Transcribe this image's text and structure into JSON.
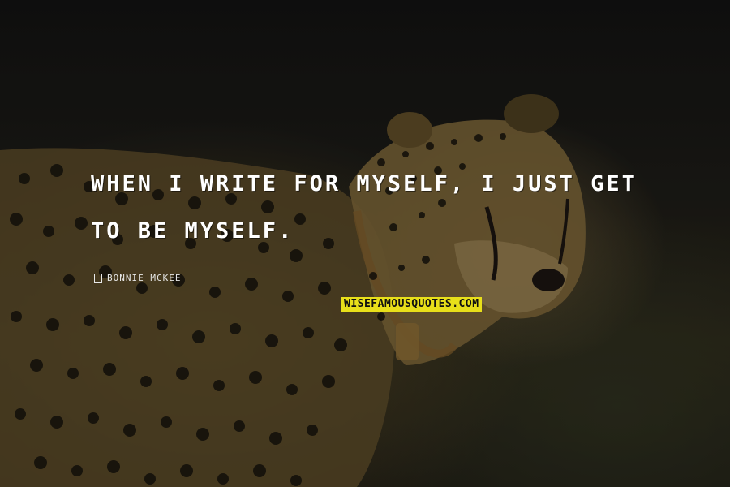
{
  "quote": {
    "text": "WHEN I WRITE FOR MYSELF, I JUST GET TO BE MYSELF."
  },
  "author": {
    "name": "BONNIE MCKEE"
  },
  "watermark": {
    "text": "WISEFAMOUSQUOTES.COM"
  },
  "background": {
    "subject": "cheetah",
    "colors": {
      "base": "#141311",
      "fur": "#6e5a31",
      "spots": "#15120c",
      "watermark_bg": "#e8df1a",
      "text": "#ffffff"
    }
  }
}
